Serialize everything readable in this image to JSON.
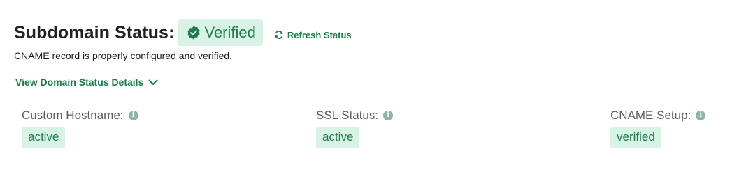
{
  "header": {
    "title": "Subdomain Status:",
    "status_badge": "Verified",
    "refresh_label": "Refresh Status"
  },
  "description": "CNAME record is properly configured and verified.",
  "details_toggle": {
    "label": "View Domain Status Details"
  },
  "fields": [
    {
      "label": "Custom Hostname:",
      "value": "active"
    },
    {
      "label": "SSL Status:",
      "value": "active"
    },
    {
      "label": "CNAME Setup:",
      "value": "verified"
    }
  ],
  "icons": {
    "status": "check-badge-icon",
    "refresh": "refresh-icon",
    "toggle": "chevron-down-icon",
    "info": "info-icon"
  },
  "colors": {
    "accent": "#1f7a4c",
    "badge_background": "#d8f3e5",
    "info_icon": "#8db5a1"
  }
}
